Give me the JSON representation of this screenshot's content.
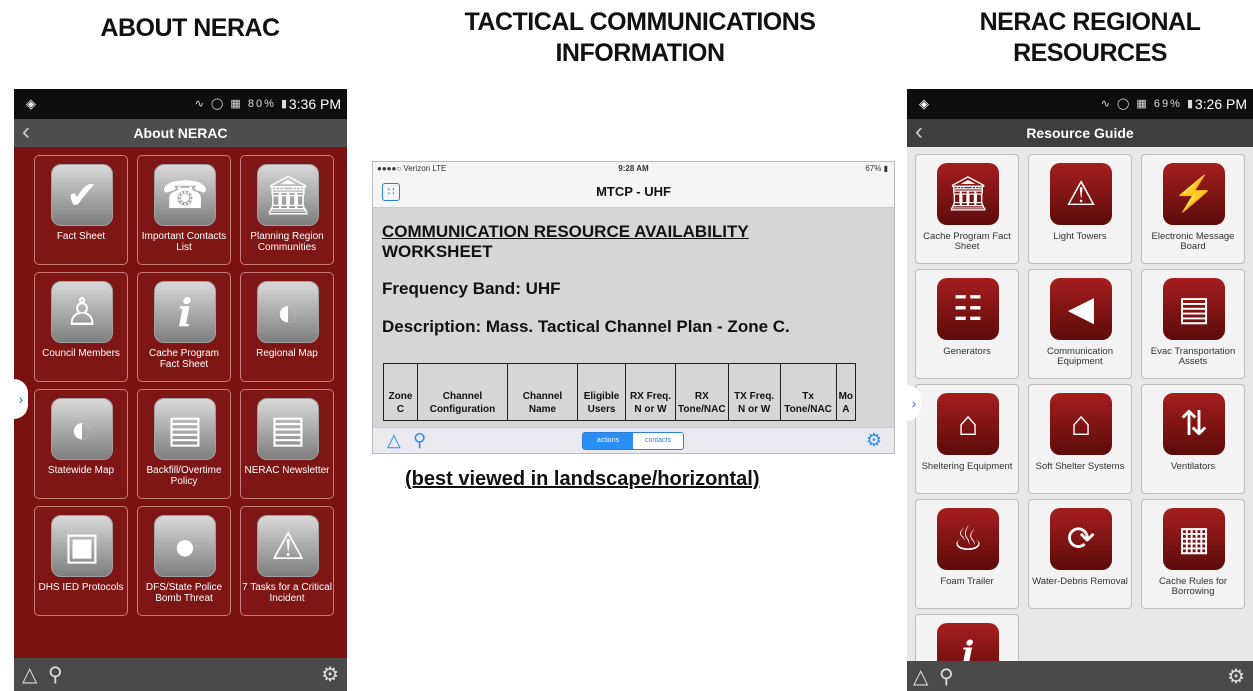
{
  "titles": {
    "about": "ABOUT NERAC",
    "tactical_line1": "TACTICAL COMMUNICATIONS",
    "tactical_line2": "INFORMATION",
    "regional_line1": "NERAC REGIONAL",
    "regional_line2": "RESOURCES"
  },
  "phone_about": {
    "status_time": "3:36 PM",
    "status_battery": "80%",
    "nav_title": "About NERAC",
    "tiles": [
      {
        "label": "Fact Sheet",
        "icon": "check-icon"
      },
      {
        "label": "Important Contacts List",
        "icon": "telephone-icon"
      },
      {
        "label": "Planning Region Communities",
        "icon": "building-icon"
      },
      {
        "label": "Council Members",
        "icon": "person-icon"
      },
      {
        "label": "Cache Program Fact Sheet",
        "icon": "info-icon"
      },
      {
        "label": "Regional Map",
        "icon": "globe-icon"
      },
      {
        "label": "Statewide Map",
        "icon": "globe-icon"
      },
      {
        "label": "Backfill/Overtime Policy",
        "icon": "document-icon"
      },
      {
        "label": "NERAC Newsletter",
        "icon": "newspaper-icon"
      },
      {
        "label": "DHS IED Protocols",
        "icon": "suspicious-package-icon"
      },
      {
        "label": "DFS/State Police Bomb Threat",
        "icon": "bomb-icon"
      },
      {
        "label": "7 Tasks for a Critical Incident",
        "icon": "warning-icon"
      }
    ]
  },
  "phone_tactical": {
    "status_carrier": "Verizon  LTE",
    "status_time": "9:28 AM",
    "status_battery": "67%",
    "nav_title": "MTCP - UHF",
    "heading_line1": "COMMUNICATION RESOURCE AVAILABILITY",
    "heading_line2": "WORKSHEET",
    "frequency_band": "Frequency Band: UHF",
    "description": "Description: Mass. Tactical Channel Plan - Zone C.",
    "table_headers": [
      "Zone C",
      "Channel Configuration",
      "Channel Name",
      "Eligible Users",
      "RX Freq. N or W",
      "RX Tone/NAC",
      "TX Freq. N or W",
      "Tx Tone/NAC",
      "Mo A"
    ],
    "tab_actions": "actions",
    "tab_contacts": "contacts"
  },
  "landscape_note": "(best viewed in landscape/horizontal)",
  "phone_resources": {
    "status_time": "3:26 PM",
    "status_battery": "69%",
    "nav_title": "Resource Guide",
    "tiles": [
      {
        "label": "Cache Program Fact Sheet",
        "icon": "building-icon"
      },
      {
        "label": "Light Towers",
        "icon": "warning-icon"
      },
      {
        "label": "Electronic Message Board",
        "icon": "lightning-icon"
      },
      {
        "label": "Generators",
        "icon": "power-tower-icon"
      },
      {
        "label": "Communication Equipment",
        "icon": "megaphone-icon"
      },
      {
        "label": "Evac Transportation Assets",
        "icon": "bus-icon"
      },
      {
        "label": "Sheltering Equipment",
        "icon": "shelter-icon"
      },
      {
        "label": "Soft Shelter Systems",
        "icon": "shelter-icon"
      },
      {
        "label": "Ventilators",
        "icon": "arrows-icon"
      },
      {
        "label": "Foam Trailer",
        "icon": "fire-icon"
      },
      {
        "label": "Water-Debris Removal",
        "icon": "cycle-icon"
      },
      {
        "label": "Cache Rules for Borrowing",
        "icon": "kiosk-icon"
      },
      {
        "label": "",
        "icon": "info-icon"
      }
    ]
  },
  "colors": {
    "about_background": "#7a1212",
    "icon_red": "#8b1414",
    "ios_blue": "#2b8ef5"
  }
}
